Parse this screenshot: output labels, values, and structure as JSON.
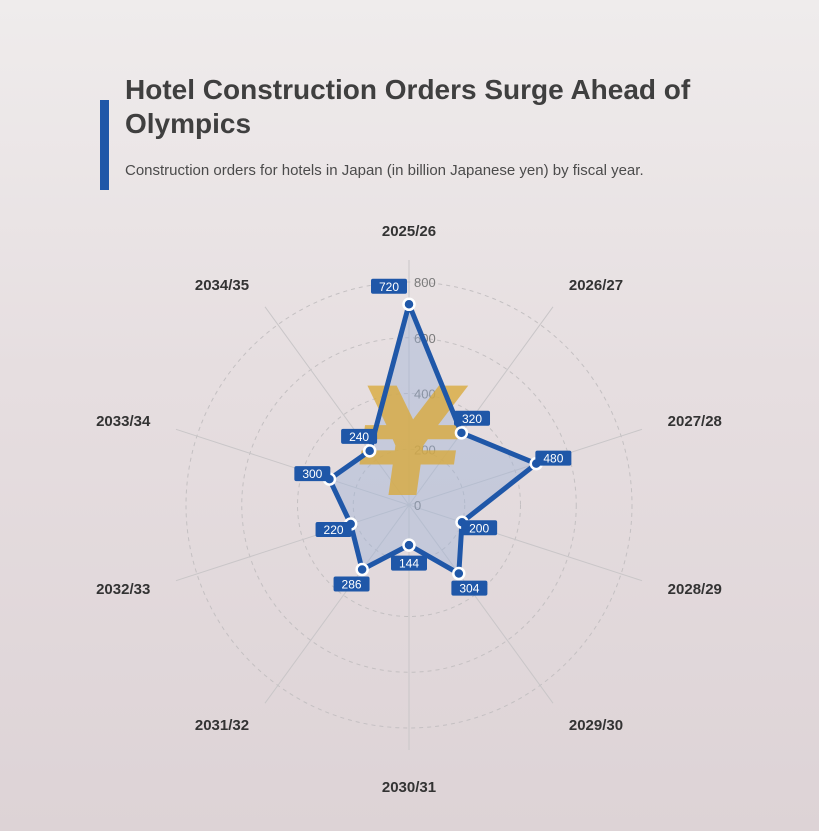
{
  "header": {
    "title": "Hotel Construction Orders Surge Ahead of Olympics",
    "subtitle": "Construction orders for hotels in Japan (in billion Japanese yen) by fiscal year."
  },
  "colors": {
    "accent": "#1f57a8",
    "series_line": "#1f57a8",
    "series_fill": "#9fb4d8",
    "label_bg": "#1f57a8",
    "yen_icon": "#d9a93a"
  },
  "icon": {
    "name": "yen-icon",
    "glyph": "¥"
  },
  "chart_data": {
    "type": "radar",
    "categories": [
      "2025/26",
      "2026/27",
      "2027/28",
      "2028/29",
      "2029/30",
      "2030/31",
      "2031/32",
      "2032/33",
      "2033/34",
      "2034/35"
    ],
    "values": [
      720,
      320,
      480,
      200,
      304,
      144,
      286,
      220,
      300,
      240
    ],
    "rlim": [
      0,
      800
    ],
    "ticks": [
      0,
      200,
      400,
      600,
      800
    ],
    "grid": true
  }
}
